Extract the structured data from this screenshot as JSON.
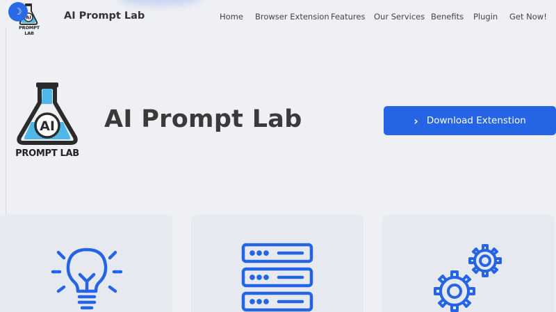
{
  "header": {
    "brand": "AI Prompt Lab",
    "theme_toggle_icon": "moon-icon",
    "logo_text": "AI",
    "logo_subtext": "PROMPT LAB",
    "nav": [
      "Home",
      "Browser Extension",
      "Features",
      "Our Services",
      "Benefits",
      "Plugin",
      "Get Now!"
    ]
  },
  "hero": {
    "logo_text": "AI",
    "logo_subtext": "PROMPT LAB",
    "title": "AI Prompt Lab",
    "download_label": "Download Extenstion",
    "download_icon": "chevron-right-icon"
  },
  "cards": [
    {
      "icon": "lightbulb-icon"
    },
    {
      "icon": "server-icon"
    },
    {
      "icon": "gears-icon"
    }
  ],
  "colors": {
    "accent": "#2565e5",
    "background": "#eef0f4",
    "card": "#e6e9ef",
    "flask_blue": "#4fb8e8",
    "text": "#3a3a3a"
  }
}
